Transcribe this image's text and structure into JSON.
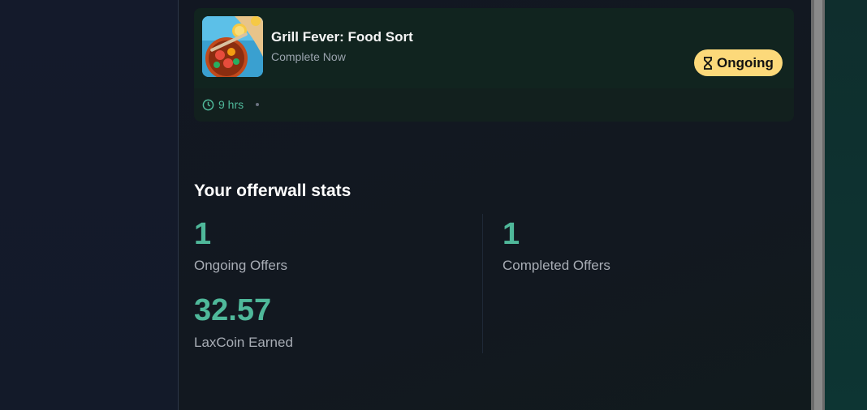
{
  "offer": {
    "title": "Grill Fever: Food Sort",
    "subtitle": "Complete Now",
    "status_label": "Ongoing",
    "duration": "9 hrs",
    "thumbnail_icon": "game-thumbnail-grill-food",
    "status_icon": "hourglass-icon",
    "duration_icon": "clock-icon"
  },
  "stats": {
    "title": "Your offerwall stats",
    "ongoing": {
      "value": "1",
      "label": "Ongoing Offers"
    },
    "completed": {
      "value": "1",
      "label": "Completed Offers"
    },
    "earned": {
      "value": "32.57",
      "label": "LaxCoin Earned"
    }
  },
  "colors": {
    "accent": "#4fb89a",
    "badge": "#fcd97a",
    "card": "#12201e",
    "panel": "#121722"
  }
}
